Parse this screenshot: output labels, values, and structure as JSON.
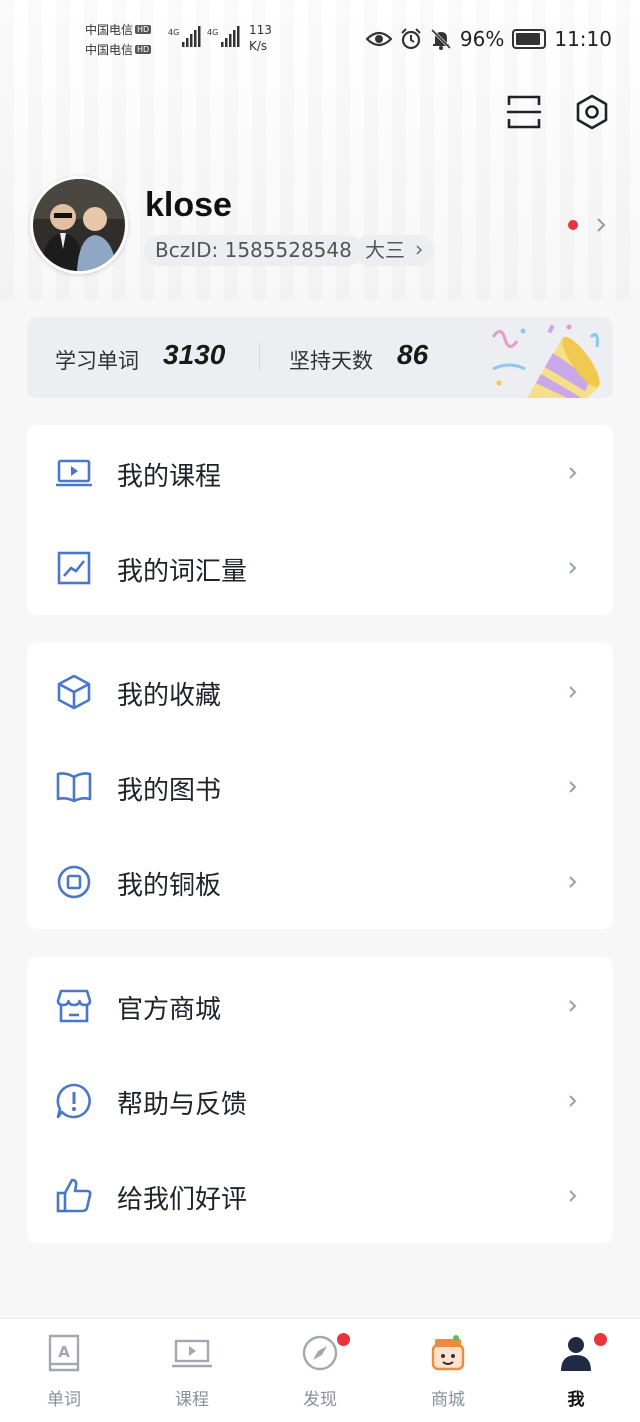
{
  "status_bar": {
    "carrier1": "中国电信",
    "carrier2": "中国电信",
    "hd_badge": "HD",
    "net_type": "4G",
    "speed_value": "113",
    "speed_unit": "K/s",
    "battery": "96%",
    "time": "11:10"
  },
  "profile": {
    "username": "klose",
    "bcz_id": "BczID: 1585528548",
    "grade": "大三"
  },
  "stats": {
    "words_label": "学习单词",
    "words_value": "3130",
    "days_label": "坚持天数",
    "days_value": "86"
  },
  "menu": {
    "courses": "我的课程",
    "vocab": "我的词汇量",
    "favorites": "我的收藏",
    "books": "我的图书",
    "coins": "我的铜板",
    "shop": "官方商城",
    "help": "帮助与反馈",
    "rate": "给我们好评"
  },
  "nav": {
    "words": "单词",
    "courses": "课程",
    "discover": "发现",
    "shop": "商城",
    "me": "我"
  },
  "colors": {
    "accent": "#4a77c9",
    "red_dot": "#e8343a",
    "page_bg": "#f7f7f8"
  }
}
